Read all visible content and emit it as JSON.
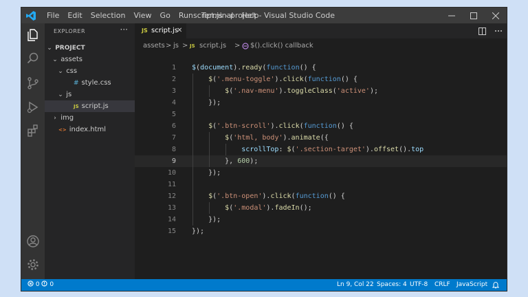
{
  "window": {
    "title": "script.js - project - Visual Studio Code",
    "menu": [
      "File",
      "Edit",
      "Selection",
      "View",
      "Go",
      "Run",
      "Terminal",
      "Help"
    ]
  },
  "colors": {
    "accent": "#007acc",
    "logo": "#23a9f2",
    "js_icon": "#cbcb41",
    "css_icon": "#519aba",
    "html_icon": "#e37933"
  },
  "activity_icons": [
    "files-icon",
    "search-icon",
    "source-control-icon",
    "run-debug-icon",
    "extensions-icon",
    "account-icon",
    "settings-gear-icon"
  ],
  "sidebar": {
    "header": "EXPLORER",
    "more": "···",
    "tree": [
      {
        "label": "PROJECT",
        "depth": 0,
        "type": "root",
        "expanded": true
      },
      {
        "label": "assets",
        "depth": 1,
        "type": "folder",
        "expanded": true
      },
      {
        "label": "css",
        "depth": 2,
        "type": "folder",
        "expanded": true
      },
      {
        "label": "style.css",
        "depth": 3,
        "type": "css",
        "icon": "#"
      },
      {
        "label": "js",
        "depth": 2,
        "type": "folder",
        "expanded": true
      },
      {
        "label": "script.js",
        "depth": 3,
        "type": "js",
        "icon": "JS",
        "selected": true
      },
      {
        "label": "img",
        "depth": 1,
        "type": "folder",
        "expanded": false
      },
      {
        "label": "index.html",
        "depth": 1,
        "type": "html",
        "icon": "<>"
      }
    ]
  },
  "editor": {
    "tab": {
      "icon": "JS",
      "label": "script.js",
      "close": "✕"
    },
    "breadcrumb": {
      "part1": "assets",
      "sep": ">",
      "part2": "js",
      "part3": "script.js",
      "part4": "$().click() callback"
    },
    "current_line": 9,
    "lines": [
      {
        "n": "1",
        "tokens": [
          [
            "var",
            "$"
          ],
          [
            "pl",
            "("
          ],
          [
            "var",
            "document"
          ],
          [
            "pl",
            ")."
          ],
          [
            "fn",
            "ready"
          ],
          [
            "pl",
            "("
          ],
          [
            "kw",
            "function"
          ],
          [
            "pl",
            "() {"
          ]
        ]
      },
      {
        "n": "2",
        "tokens": [
          [
            "pl",
            "    "
          ],
          [
            "fn",
            "$"
          ],
          [
            "pl",
            "("
          ],
          [
            "str",
            "'.menu-toggle'"
          ],
          [
            "pl",
            ")."
          ],
          [
            "fn",
            "click"
          ],
          [
            "pl",
            "("
          ],
          [
            "kw",
            "function"
          ],
          [
            "pl",
            "() {"
          ]
        ]
      },
      {
        "n": "3",
        "tokens": [
          [
            "pl",
            "        "
          ],
          [
            "fn",
            "$"
          ],
          [
            "pl",
            "("
          ],
          [
            "str",
            "'.nav-menu'"
          ],
          [
            "pl",
            ")."
          ],
          [
            "fn",
            "toggleClass"
          ],
          [
            "pl",
            "("
          ],
          [
            "str",
            "'active'"
          ],
          [
            "pl",
            ");"
          ]
        ]
      },
      {
        "n": "4",
        "tokens": [
          [
            "pl",
            "    });"
          ]
        ]
      },
      {
        "n": "5",
        "tokens": []
      },
      {
        "n": "6",
        "tokens": [
          [
            "pl",
            "    "
          ],
          [
            "fn",
            "$"
          ],
          [
            "pl",
            "("
          ],
          [
            "str",
            "'.btn-scroll'"
          ],
          [
            "pl",
            ")."
          ],
          [
            "fn",
            "click"
          ],
          [
            "pl",
            "("
          ],
          [
            "kw",
            "function"
          ],
          [
            "pl",
            "() {"
          ]
        ]
      },
      {
        "n": "7",
        "tokens": [
          [
            "pl",
            "        "
          ],
          [
            "fn",
            "$"
          ],
          [
            "pl",
            "("
          ],
          [
            "str",
            "'html, body'"
          ],
          [
            "pl",
            ")."
          ],
          [
            "fn",
            "animate"
          ],
          [
            "pl",
            "({"
          ]
        ]
      },
      {
        "n": "8",
        "tokens": [
          [
            "pl",
            "            "
          ],
          [
            "prop",
            "scrollTop"
          ],
          [
            "pl",
            ": "
          ],
          [
            "fn",
            "$"
          ],
          [
            "pl",
            "("
          ],
          [
            "str",
            "'.section-target'"
          ],
          [
            "pl",
            ")."
          ],
          [
            "fn",
            "offset"
          ],
          [
            "pl",
            "()."
          ],
          [
            "prop",
            "top"
          ]
        ]
      },
      {
        "n": "9",
        "tokens": [
          [
            "pl",
            "        }, "
          ],
          [
            "num",
            "600"
          ],
          [
            "pl",
            ");"
          ]
        ]
      },
      {
        "n": "10",
        "tokens": [
          [
            "pl",
            "    });"
          ]
        ]
      },
      {
        "n": "11",
        "tokens": []
      },
      {
        "n": "12",
        "tokens": [
          [
            "pl",
            "    "
          ],
          [
            "fn",
            "$"
          ],
          [
            "pl",
            "("
          ],
          [
            "str",
            "'.btn-open'"
          ],
          [
            "pl",
            ")."
          ],
          [
            "fn",
            "click"
          ],
          [
            "pl",
            "("
          ],
          [
            "kw",
            "function"
          ],
          [
            "pl",
            "() {"
          ]
        ]
      },
      {
        "n": "13",
        "tokens": [
          [
            "pl",
            "        "
          ],
          [
            "fn",
            "$"
          ],
          [
            "pl",
            "("
          ],
          [
            "str",
            "'.modal'"
          ],
          [
            "pl",
            ")."
          ],
          [
            "fn",
            "fadeIn"
          ],
          [
            "pl",
            "();"
          ]
        ]
      },
      {
        "n": "14",
        "tokens": [
          [
            "pl",
            "    });"
          ]
        ]
      },
      {
        "n": "15",
        "tokens": [
          [
            "pl",
            "});"
          ]
        ]
      }
    ]
  },
  "statusbar": {
    "errors": "0",
    "warnings": "0",
    "position": "Ln 9, Col 22",
    "spaces": "Spaces: 4",
    "encoding": "UTF-8",
    "eol": "CRLF",
    "language": "JavaScript"
  }
}
